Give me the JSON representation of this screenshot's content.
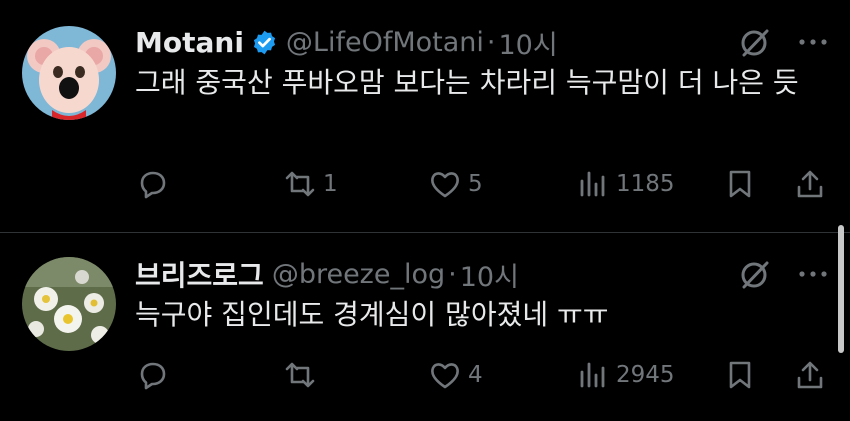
{
  "tweets": [
    {
      "name": "Motani",
      "handle": "@LifeOfMotani",
      "separator": "·",
      "time": "10시",
      "text": "그래 중국산 푸바오맘 보다는  차라리 늑구맘이 더 나은 듯",
      "retweets": "1",
      "likes": "5",
      "views": "1185",
      "verified": true
    },
    {
      "name": "브리즈로그",
      "handle": "@breeze_log",
      "separator": "·",
      "time": "10시",
      "text": "늑구야 집인데도 경계심이 많아졌네 ㅠㅠ",
      "retweets": "",
      "likes": "4",
      "views": "2945",
      "verified": false
    }
  ],
  "icons": {
    "verified": "verified-badge-icon",
    "grok": "grok-icon",
    "more": "more-icon",
    "reply": "reply-icon",
    "retweet": "retweet-icon",
    "like": "like-icon",
    "views": "views-icon",
    "bookmark": "bookmark-icon",
    "share": "share-icon"
  },
  "colors": {
    "background": "#000000",
    "text": "#e7e9ea",
    "secondary": "#71767b",
    "verified": "#1d9bf0"
  }
}
